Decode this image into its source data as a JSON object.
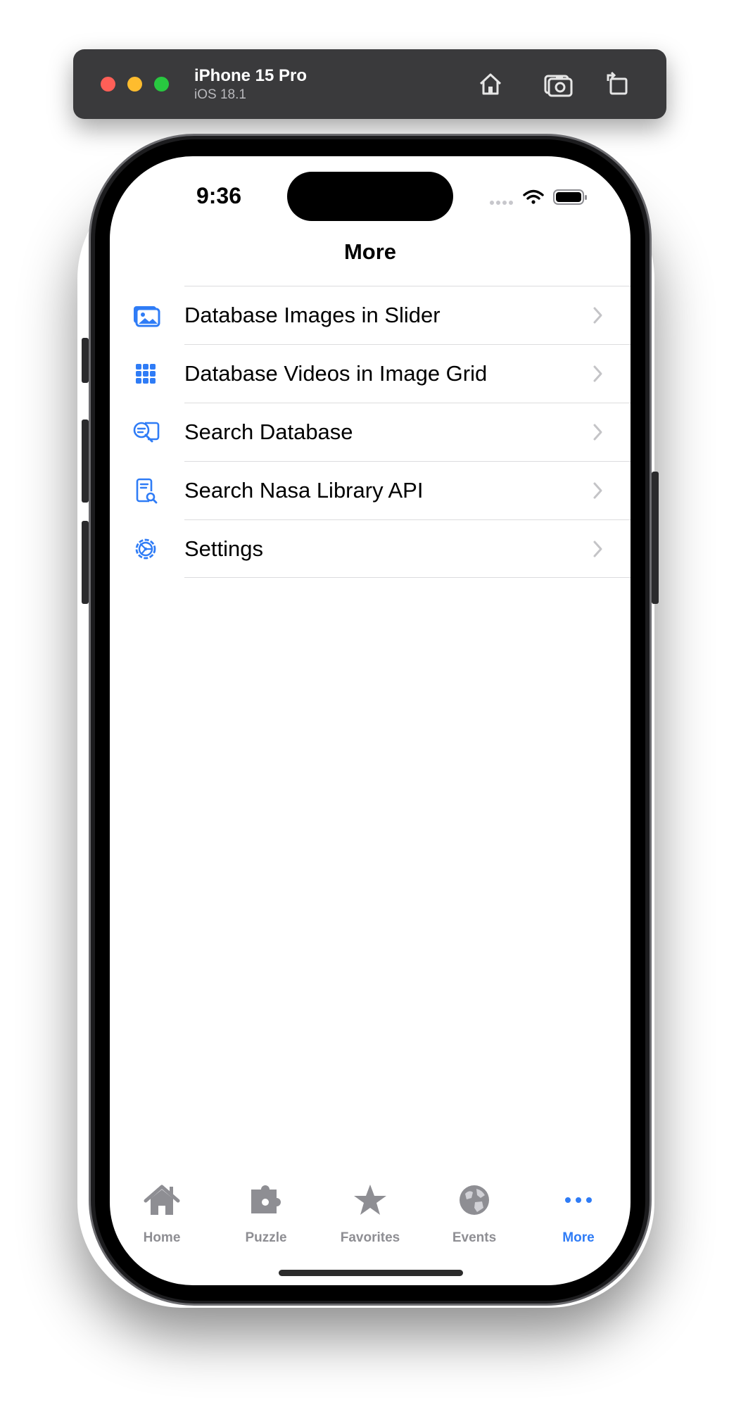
{
  "simulator": {
    "device_name": "iPhone 15 Pro",
    "os_version": "iOS 18.1",
    "buttons": [
      "home-icon",
      "screenshot-icon",
      "rotate-icon"
    ]
  },
  "status_bar": {
    "time": "9:36"
  },
  "nav": {
    "title": "More"
  },
  "menu": {
    "items": [
      {
        "label": "Database Images in Slider",
        "icon": "photos-icon"
      },
      {
        "label": "Database Videos in Image Grid",
        "icon": "grid-icon"
      },
      {
        "label": "Search Database",
        "icon": "search-bubble-icon"
      },
      {
        "label": "Search Nasa Library API",
        "icon": "doc-search-icon"
      },
      {
        "label": "Settings",
        "icon": "settings-gear-icon"
      }
    ]
  },
  "tabbar": {
    "tabs": [
      {
        "label": "Home",
        "icon": "house-icon"
      },
      {
        "label": "Puzzle",
        "icon": "puzzle-icon"
      },
      {
        "label": "Favorites",
        "icon": "star-icon"
      },
      {
        "label": "Events",
        "icon": "globe-icon"
      },
      {
        "label": "More",
        "icon": "ellipsis-icon",
        "active": true
      }
    ]
  },
  "colors": {
    "accent": "#2f7cf6",
    "inactive": "#8e8e93"
  }
}
